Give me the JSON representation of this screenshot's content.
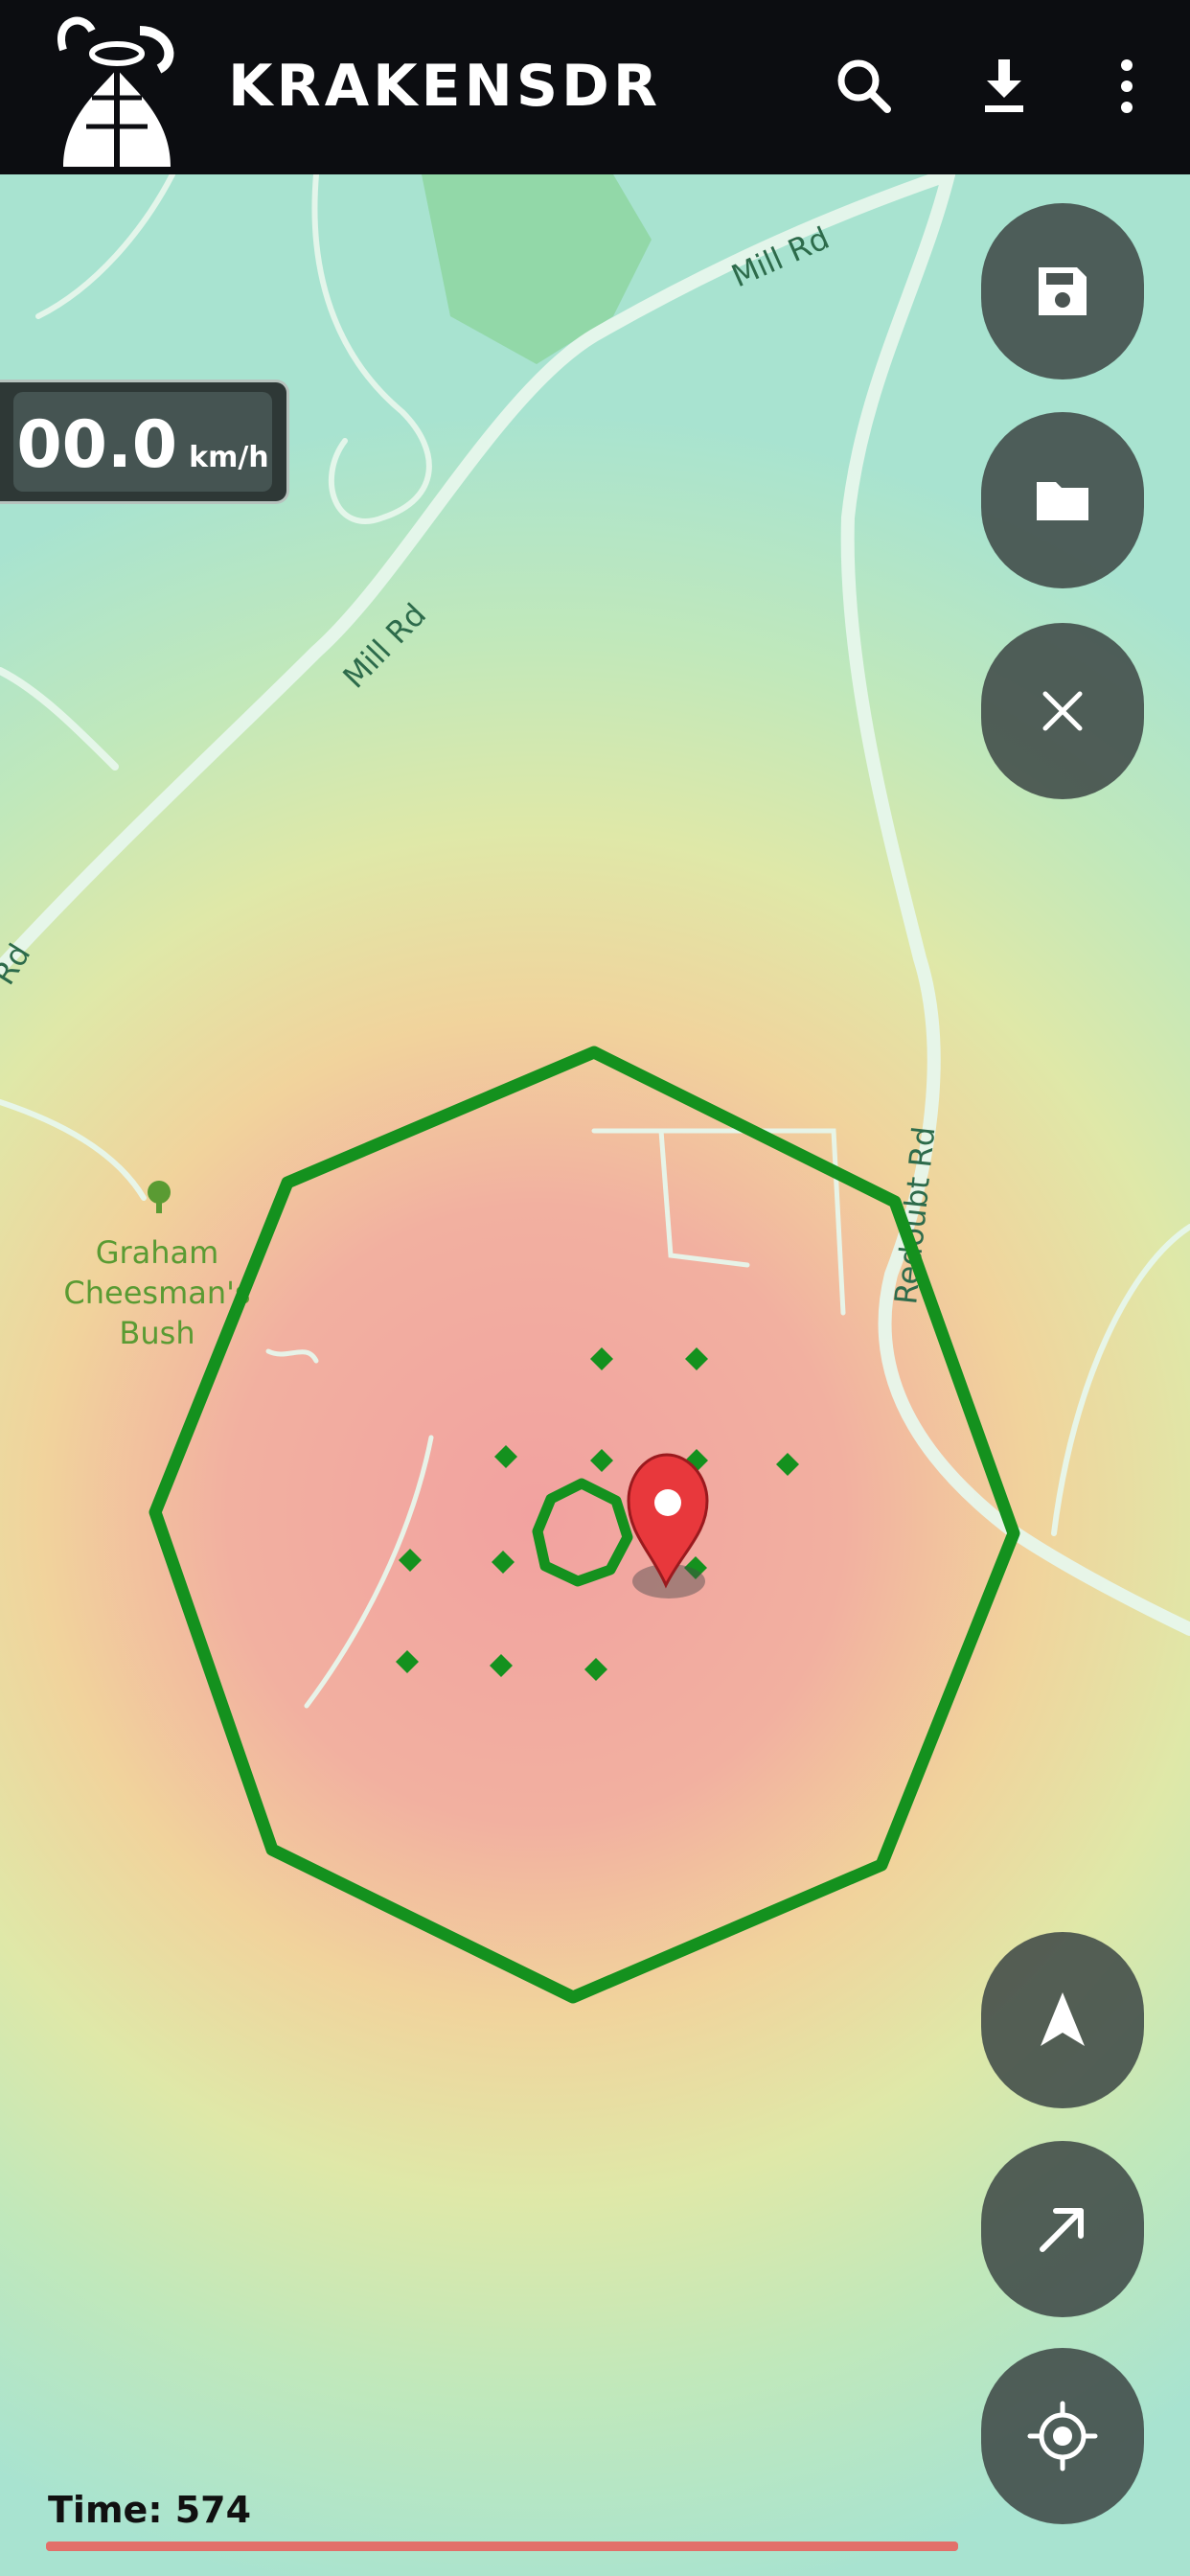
{
  "app": {
    "title": "KRAKENSDR",
    "search_icon": "search-icon",
    "download_icon": "download-icon",
    "menu_icon": "more-vert-icon"
  },
  "speed": {
    "value": "00.0",
    "unit": "km/h"
  },
  "map": {
    "road_labels": [
      "Mill Rd",
      "Mill Rd",
      "Rd",
      "Redoubt Rd"
    ],
    "park_label_lines": [
      "Graham",
      "Cheesman's",
      "Bush"
    ],
    "colors": {
      "hot": "#f2a3a3",
      "warm": "#f0d79a",
      "cool": "#b9e9c2",
      "ring": "#14911e",
      "marker": "#e8383c"
    }
  },
  "controls": [
    {
      "name": "save-button",
      "icon": "save-icon"
    },
    {
      "name": "open-folder-button",
      "icon": "folder-icon"
    },
    {
      "name": "clear-button",
      "icon": "close-icon"
    },
    {
      "name": "navigation-button",
      "icon": "navigation-arrow-icon"
    },
    {
      "name": "direction-button",
      "icon": "arrow-up-right-icon"
    },
    {
      "name": "my-location-button",
      "icon": "gps-fixed-icon"
    }
  ],
  "status": {
    "time_text": "Time: 574",
    "progress": 1.0
  }
}
